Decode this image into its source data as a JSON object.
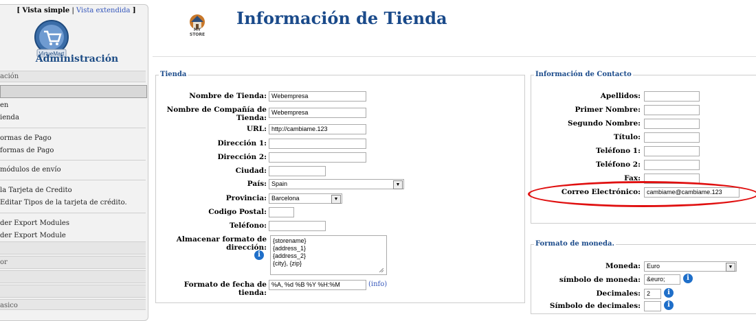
{
  "sidebar": {
    "view_simple": "[ Vista simple",
    "view_sep": " | ",
    "view_extended": "Vista extendida",
    "view_close": " ]",
    "logo_text": "VirtueMart",
    "title": "Administración",
    "items": [
      {
        "label": "ación",
        "style": "band"
      },
      {
        "label": "",
        "style": "band-active"
      },
      {
        "label": "en",
        "style": "text"
      },
      {
        "label": "ienda",
        "style": "text"
      },
      {
        "label": "ormas de Pago",
        "style": "text"
      },
      {
        "label": "formas de Pago",
        "style": "text"
      },
      {
        "label": " módulos de envío",
        "style": "text"
      },
      {
        "label": " la Tarjeta de Credito",
        "style": "text"
      },
      {
        "label": " Editar Tipos de la tarjeta de crédito.",
        "style": "text"
      },
      {
        "label": "der Export Modules",
        "style": "text"
      },
      {
        "label": "der Export Module",
        "style": "text"
      },
      {
        "label": "or",
        "style": "band"
      },
      {
        "label": "asico",
        "style": "band"
      }
    ]
  },
  "header": {
    "icon_label": "MY STORE",
    "title": "Información de Tienda"
  },
  "tienda": {
    "legend": "Tienda",
    "fields": {
      "nombre_tienda": {
        "label": "Nombre de Tienda:",
        "value": "Webempresa"
      },
      "nombre_compania": {
        "label": "Nombre de Compañía de Tienda:",
        "value": "Webempresa"
      },
      "url": {
        "label": "URL:",
        "value": "http://cambiame.123"
      },
      "direccion1": {
        "label": "Dirección 1:",
        "value": ""
      },
      "direccion2": {
        "label": "Dirección 2:",
        "value": ""
      },
      "ciudad": {
        "label": "Ciudad:",
        "value": ""
      },
      "pais": {
        "label": "País:",
        "value": "Spain"
      },
      "provincia": {
        "label": "Provincia:",
        "value": "Barcelona"
      },
      "codigo_postal": {
        "label": "Codigo Postal:",
        "value": ""
      },
      "telefono": {
        "label": "Teléfono:",
        "value": ""
      },
      "formato_direccion": {
        "label": "Almacenar formato de dirección:",
        "lines": [
          "{storename}",
          "{address_1}",
          "{address_2}",
          "{city}, {zip}"
        ]
      },
      "formato_fecha": {
        "label": "Formato de fecha de tienda:",
        "value": "%A, %d %B %Y %H:%M",
        "info": "(info)"
      }
    }
  },
  "contacto": {
    "legend": "Información de Contacto",
    "fields": {
      "apellidos": {
        "label": "Apellidos:",
        "value": ""
      },
      "primer_nombre": {
        "label": "Primer Nombre:",
        "value": ""
      },
      "segundo_nombre": {
        "label": "Segundo Nombre:",
        "value": ""
      },
      "titulo": {
        "label": "Título:",
        "value": ""
      },
      "telefono1": {
        "label": "Teléfono 1:",
        "value": ""
      },
      "telefono2": {
        "label": "Teléfono 2:",
        "value": ""
      },
      "fax": {
        "label": "Fax:",
        "value": ""
      },
      "correo": {
        "label": "Correo Electrónico:",
        "value": "cambiame@cambiame.123"
      }
    }
  },
  "moneda": {
    "legend": "Formato de moneda.",
    "fields": {
      "moneda": {
        "label": "Moneda:",
        "value": "Euro"
      },
      "simbolo": {
        "label": "símbolo de moneda:",
        "value": "&euro;"
      },
      "decimales": {
        "label": "Decimales:",
        "value": "2"
      },
      "simbolo_decimales": {
        "label": "Símbolo de decimales:",
        "value": ""
      }
    }
  },
  "colors": {
    "accent": "#1a4a8a",
    "highlight": "#e01010",
    "info": "#1f6fc9"
  }
}
